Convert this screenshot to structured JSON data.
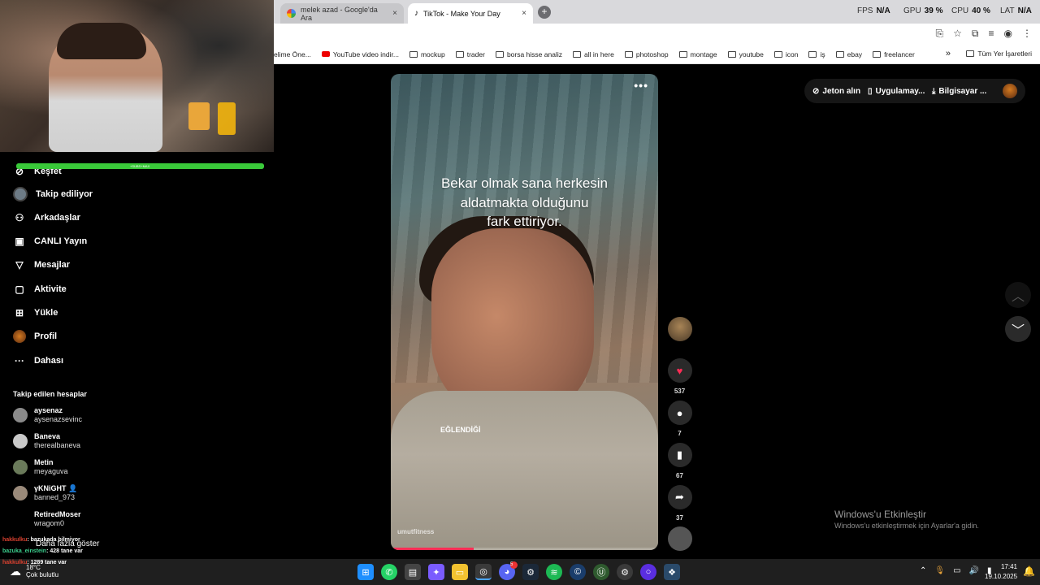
{
  "browser": {
    "tabs": [
      {
        "title": "melek azad - Google'da Ara",
        "close": "×"
      },
      {
        "title": "TikTok - Make Your Day",
        "close": "×"
      }
    ],
    "new_tab": "+",
    "perf": [
      {
        "label": "FPS",
        "value": "N/A"
      },
      {
        "label": "GPU",
        "value": "39 %"
      },
      {
        "label": "CPU",
        "value": "40 %"
      },
      {
        "label": "LAT",
        "value": "N/A"
      }
    ],
    "bookmarks": [
      "elime Öne...",
      "YouTube video indir...",
      "mockup",
      "trader",
      "borsa hisse analiz",
      "all in here",
      "photoshop",
      "montage",
      "youtube",
      "icon",
      "iş",
      "ebay",
      "freelancer"
    ],
    "bookmarks_more": "»",
    "all_bookmarks": "Tüm Yer İşaretleri"
  },
  "overlay": {
    "progress_value": 1.0,
    "progress_label": "+SUBS+MAX"
  },
  "sidebar": {
    "nav": [
      {
        "label": "Keşfet",
        "icon": "compass-icon",
        "glyph": "⊘"
      },
      {
        "label": "Takip ediliyor",
        "icon": "following-avatar-icon",
        "glyph": ""
      },
      {
        "label": "Arkadaşlar",
        "icon": "friends-icon",
        "glyph": "⚇"
      },
      {
        "label": "CANLI Yayın",
        "icon": "live-icon",
        "glyph": "▣"
      },
      {
        "label": "Mesajlar",
        "icon": "messages-icon",
        "glyph": "▽"
      },
      {
        "label": "Aktivite",
        "icon": "activity-icon",
        "glyph": "▢"
      },
      {
        "label": "Yükle",
        "icon": "upload-icon",
        "glyph": "⊞"
      },
      {
        "label": "Profil",
        "icon": "profile-icon",
        "glyph": ""
      },
      {
        "label": "Dahası",
        "icon": "more-icon",
        "glyph": "···"
      }
    ],
    "followed_title": "Takip edilen hesaplar",
    "followed": [
      {
        "name": "aysenaz",
        "handle": "aysenazsevinc"
      },
      {
        "name": "Baneva",
        "handle": "therealbaneva"
      },
      {
        "name": "Metin",
        "handle": "meyaguva"
      },
      {
        "name": "γKNiGHT 👤",
        "handle": "banned_973"
      },
      {
        "name": "RetiredMoser",
        "handle": "wragom0"
      }
    ],
    "show_more": "Daha fazla göster"
  },
  "chat": [
    {
      "user": "hakkulku",
      "msg": ": bazukada bilmiyor"
    },
    {
      "user": "bazuka_einstein",
      "msg": ": 428 tane var"
    },
    {
      "user": "hakkulku",
      "msg": ": 1289 tane var"
    }
  ],
  "video": {
    "caption": [
      "Bekar olmak sana herkesin",
      "aldatmakta olduğunu",
      "fark ettiriyor."
    ],
    "more": "•••",
    "sticker": "EĞLENDİĞİ",
    "watermark": "umutfitness",
    "progress": 0.31
  },
  "actions": {
    "likes": "537",
    "comments": "7",
    "saves": "67",
    "shares": "37"
  },
  "top_right": {
    "coins": "Jeton alın",
    "app": "Uygulamay...",
    "computer": "Bilgisayar ..."
  },
  "windows_activation": {
    "title": "Windows'u Etkinleştir",
    "subtitle": "Windows'u etkinleştirmek için Ayarlar'a gidin."
  },
  "taskbar": {
    "weather_temp": "18°C",
    "weather_desc": "Çok bulutlu",
    "time": "17:41",
    "date": "19.10.2025",
    "discord_badge": "5"
  }
}
